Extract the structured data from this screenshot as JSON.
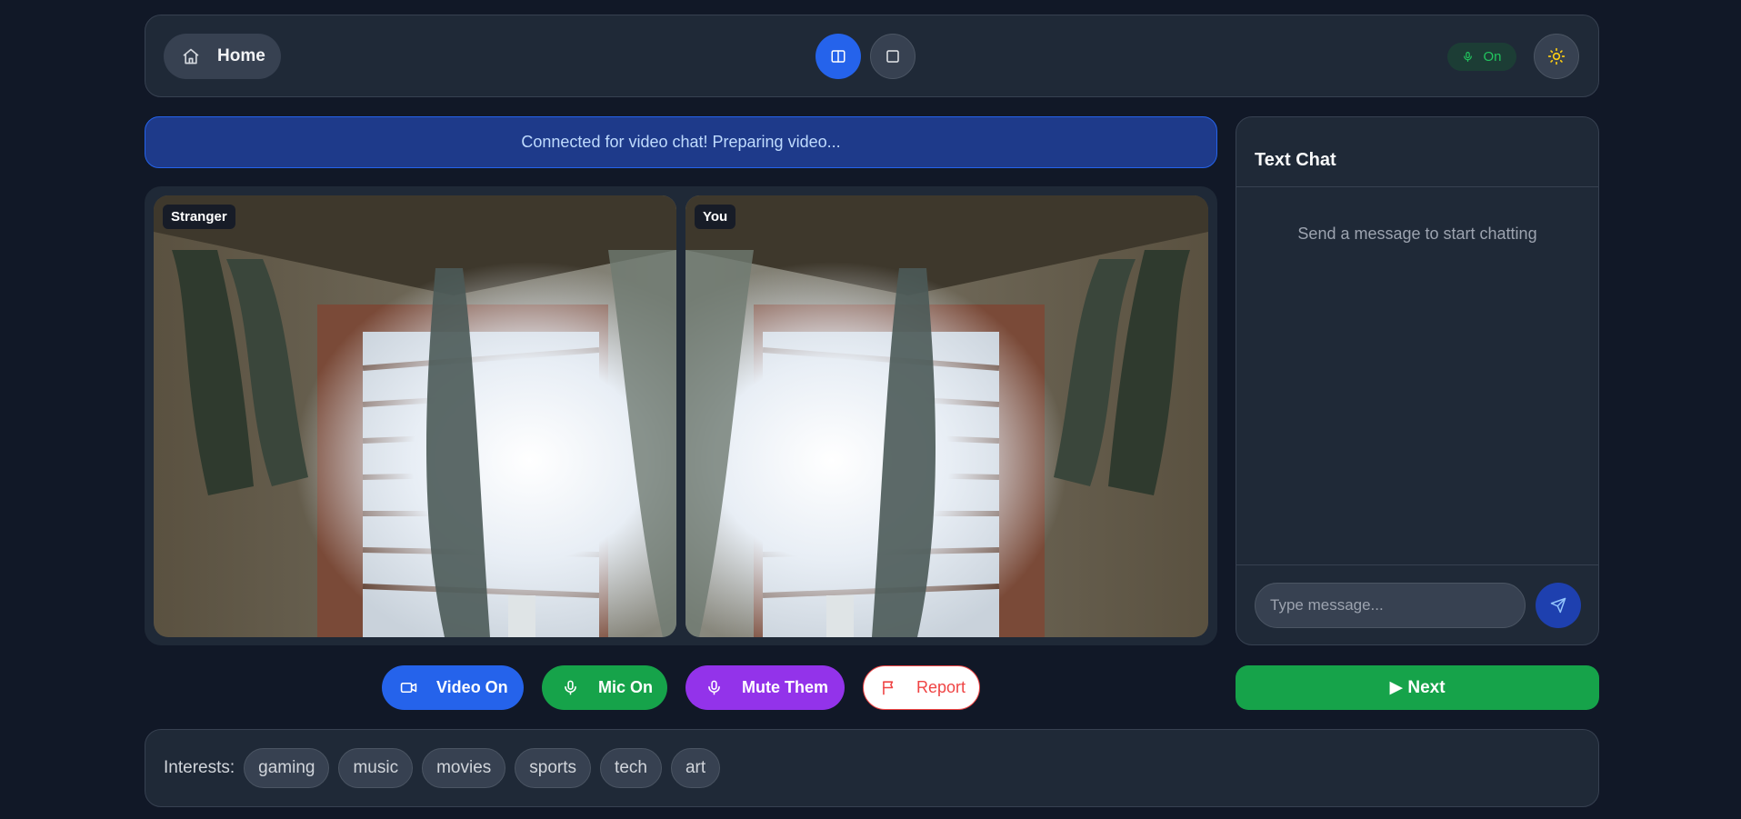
{
  "header": {
    "home_label": "Home",
    "mic_status": "On",
    "accent": "#2563eb"
  },
  "status_banner": "Connected for video chat! Preparing video...",
  "videos": {
    "stranger_label": "Stranger",
    "you_label": "You"
  },
  "controls": {
    "video_label": "Video On",
    "mic_label": "Mic On",
    "mute_label": "Mute Them",
    "report_label": "Report"
  },
  "chat": {
    "title": "Text Chat",
    "empty_text": "Send a message to start chatting",
    "input_placeholder": "Type message...",
    "input_value": ""
  },
  "next_label": "▶ Next",
  "interests": {
    "label": "Interests:",
    "items": [
      "gaming",
      "music",
      "movies",
      "sports",
      "tech",
      "art"
    ]
  },
  "icons": [
    "home-icon",
    "split-layout-icon",
    "single-layout-icon",
    "mic-icon",
    "sun-icon",
    "video-icon",
    "flag-icon",
    "send-icon"
  ],
  "colors": {
    "video_on": "#2563eb",
    "mic_on": "#16a34a",
    "mute_them": "#9333ea",
    "report": "#ef4444",
    "next": "#16a34a",
    "mic_status": "#22c55e",
    "theme_icon": "#facc15"
  }
}
